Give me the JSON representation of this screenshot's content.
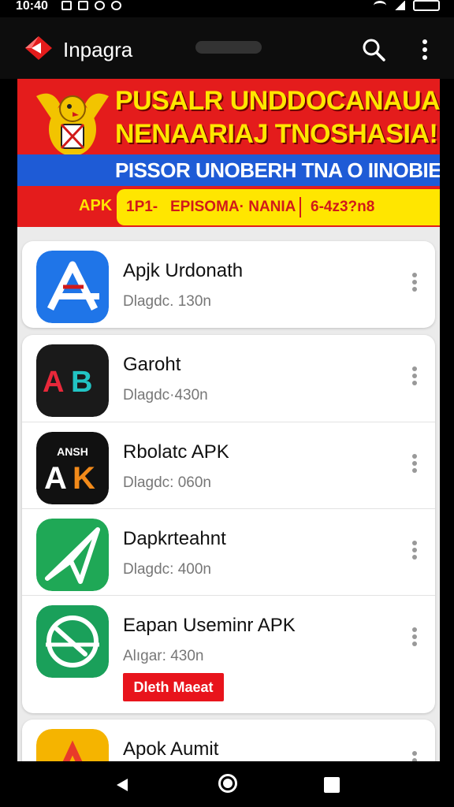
{
  "status_bar": {
    "time": "10:40",
    "left_icons": [
      "notification-icon",
      "image-icon",
      "gallery-icon",
      "whatsapp-icon",
      "app-icon"
    ],
    "right_icons": [
      "wifi-icon",
      "signal-icon",
      "battery-icon"
    ]
  },
  "app_bar": {
    "title": "Inpagra",
    "search_icon": "search-icon",
    "menu_icon": "more-vert-icon",
    "accent": "#e41c1c"
  },
  "banner": {
    "line1": "PUSALR UNDDOCANAUAR",
    "line2": "NENAARIAJ TNOSHASIA!",
    "line3": "PISSOR UNOBERH TNA O IINOBIES",
    "apk_label": "APK",
    "pill_left": "1P1-",
    "pill_middle": "EPISOMA· NANIA",
    "pill_right": "6-4z3?n8",
    "colors": {
      "red": "#e41c1c",
      "yellow": "#ffe600",
      "blue": "#1e5bd6"
    }
  },
  "apps": [
    {
      "title": "Apjk Urdonath",
      "meta": "Dlagdc. 130n",
      "icon": "app-store-a-icon",
      "icon_bg": "#1f75e8"
    },
    {
      "title": "Garoht",
      "meta": "Dlagdc·430n",
      "icon": "ab-logo-icon",
      "icon_bg": "#1a1a1a"
    },
    {
      "title": "Rbolatc APK",
      "meta": "Dlagdc: 060n",
      "icon": "ak-logo-icon",
      "icon_bg": "#111111",
      "icon_text": "ANSH"
    },
    {
      "title": "Dapkrteahnt",
      "meta": "Dlagdc: 400n",
      "icon": "paper-plane-icon",
      "icon_bg": "#1fa856"
    },
    {
      "title": "Eapan Useminr APK",
      "meta": "Alıgar: 430n",
      "icon": "stopwatch-icon",
      "icon_bg": "#1aa05a",
      "badge": "Dleth Maeat"
    },
    {
      "title": "Apok Aumit",
      "icon": "a-logo-icon",
      "icon_bg": "#f5b400"
    }
  ],
  "nav_bar": {
    "back_icon": "back-icon",
    "home_icon": "home-icon",
    "recents_icon": "recents-icon"
  }
}
